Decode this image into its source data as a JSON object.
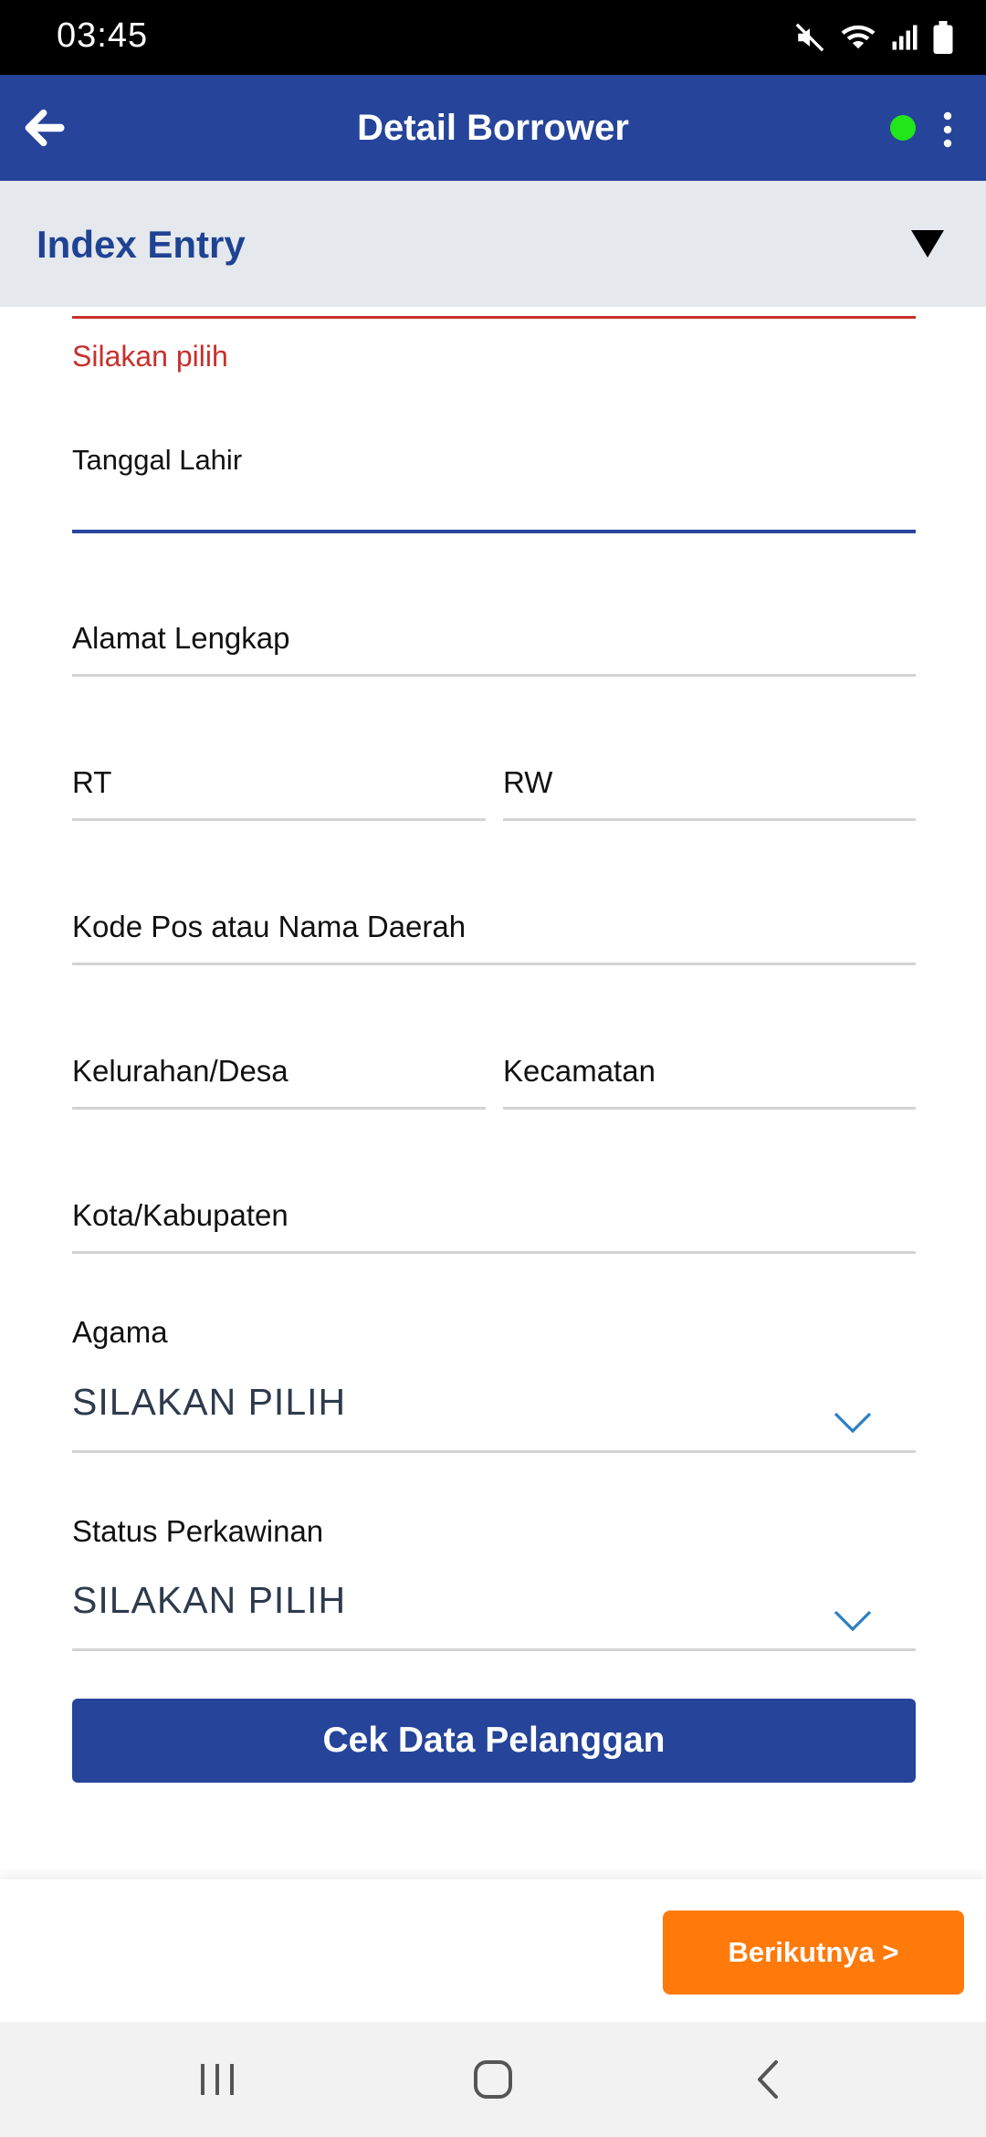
{
  "status_bar": {
    "time": "03:45",
    "icons": [
      "mute-icon",
      "wifi-icon",
      "signal-icon",
      "battery-icon"
    ]
  },
  "app_bar": {
    "title": "Detail Borrower",
    "status_color": "#22e51a"
  },
  "section": {
    "label": "Index Entry"
  },
  "form": {
    "error_text": "Silakan pilih",
    "birth_date_label": "Tanggal Lahir",
    "address_label": "Alamat Lengkap",
    "rt_label": "RT",
    "rw_label": "RW",
    "postal_label": "Kode Pos atau Nama Daerah",
    "village_label": "Kelurahan/Desa",
    "district_label": "Kecamatan",
    "city_label": "Kota/Kabupaten",
    "religion": {
      "label": "Agama",
      "value": "SILAKAN PILIH"
    },
    "marital": {
      "label": "Status Perkawinan",
      "value": "SILAKAN PILIH"
    },
    "check_button": "Cek Data Pelanggan"
  },
  "bottom_bar": {
    "next_button": "Berikutnya >"
  },
  "colors": {
    "primary": "#25449a",
    "accent": "#ff7a0a",
    "error": "#c9302c"
  }
}
